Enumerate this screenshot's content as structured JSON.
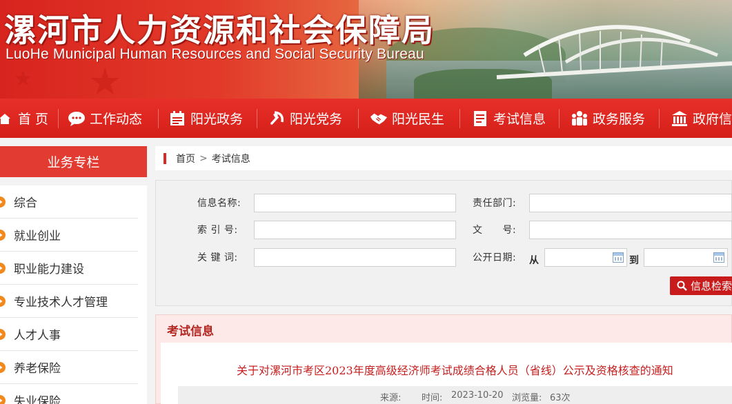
{
  "header": {
    "title_cn": "漯河市人力资源和社会保障局",
    "title_en": "LuoHe Municipal Human Resources and Social Security Bureau"
  },
  "nav": {
    "items": [
      {
        "label": "首 页",
        "icon": "home-icon"
      },
      {
        "label": "工作动态",
        "icon": "chat-bubble-icon"
      },
      {
        "label": "阳光政务",
        "icon": "calendar-icon"
      },
      {
        "label": "阳光党务",
        "icon": "party-emblem-icon"
      },
      {
        "label": "阳光民生",
        "icon": "handshake-icon"
      },
      {
        "label": "考试信息",
        "icon": "document-icon"
      },
      {
        "label": "政务服务",
        "icon": "people-icon"
      },
      {
        "label": "政府信",
        "icon": "government-building-icon"
      }
    ]
  },
  "sidebar": {
    "title": "业务专栏",
    "items": [
      {
        "label": "综合"
      },
      {
        "label": "就业创业"
      },
      {
        "label": "职业能力建设"
      },
      {
        "label": "专业技术人才管理"
      },
      {
        "label": "人才人事"
      },
      {
        "label": "养老保险"
      },
      {
        "label": "失业保险"
      }
    ]
  },
  "breadcrumb": {
    "home": "首页",
    "separator": ">",
    "current": "考试信息"
  },
  "search": {
    "name_label": "信息名称:",
    "dept_label": "责任部门:",
    "index_label": "索 引 号:",
    "doc_label": "文　　号:",
    "keyword_label": "关 键 词:",
    "date_label": "公开日期:",
    "from_label": "从",
    "to_label": "到",
    "submit_label": "信息检索",
    "name_value": "",
    "dept_value": "",
    "index_value": "",
    "doc_value": "",
    "keyword_value": "",
    "date_from_value": "",
    "date_to_value": ""
  },
  "content": {
    "section_title": "考试信息",
    "article_title": "关于对漯河市考区2023年度高级经济师考试成绩合格人员（省线）公示及资格核查的通知",
    "source_label": "来源:",
    "source_value": "",
    "time_label": "时间:",
    "time_value": "2023-10-20",
    "views_label": "浏览量:",
    "views_value": "63次"
  },
  "colors": {
    "brand_red": "#d41e18",
    "sidebar_red": "#e23c32",
    "bullet_orange": "#f08a1e",
    "title_red": "#c61f1f"
  }
}
